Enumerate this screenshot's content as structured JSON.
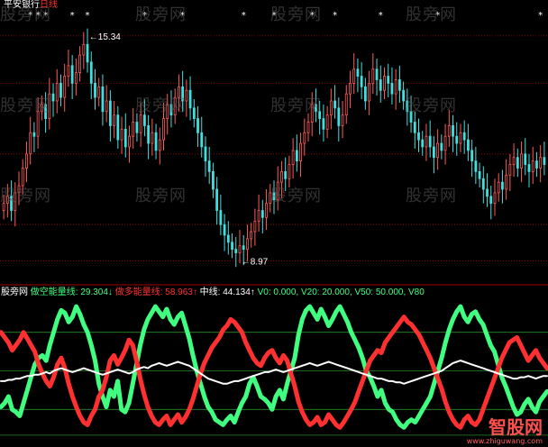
{
  "top_panel": {
    "stock_name": "平安银行",
    "period": "日线",
    "high_marker": "15.34",
    "low_marker": "8.97",
    "colors": {
      "up": "#ff5a5a",
      "down": "#40e0e0",
      "grid": "#a00000",
      "star": "#ffffff"
    }
  },
  "bottom_panel": {
    "indicator_name": "股旁网",
    "items": [
      {
        "label": "做空能量线: ",
        "value": "29.304↓",
        "color": "#40ff80"
      },
      {
        "label": "做多能量线: ",
        "value": "58.963↑",
        "color": "#ff3030"
      },
      {
        "label": "中线: ",
        "value": "44.134↑",
        "color": "#ffffff"
      },
      {
        "label": "V0: ",
        "value": "0.000",
        "color": "#40ff80"
      },
      {
        "label": "V20: ",
        "value": "20.000",
        "color": "#40ff80"
      },
      {
        "label": "V50: ",
        "value": "50.000",
        "color": "#40ff80"
      },
      {
        "label": "V80",
        "value": "",
        "color": "#40ff80"
      }
    ],
    "ref_levels": [
      0,
      20,
      50,
      80
    ]
  },
  "watermark": "股旁网",
  "brand": {
    "main": "智股网",
    "sub": "www.zhiguwang.com"
  },
  "chart_data": [
    {
      "type": "candlestick",
      "title": "平安银行 日线",
      "ylim": [
        8.5,
        16.0
      ],
      "annotations": [
        {
          "text": "15.34",
          "kind": "high",
          "value": 15.34
        },
        {
          "text": "8.97",
          "kind": "low",
          "value": 8.97
        }
      ],
      "closes": [
        10.6,
        10.8,
        10.4,
        10.9,
        11.1,
        11.6,
        12.0,
        12.6,
        12.5,
        13.2,
        13.4,
        13.0,
        13.7,
        13.5,
        14.0,
        13.6,
        14.2,
        14.5,
        14.0,
        14.3,
        14.8,
        15.1,
        14.6,
        14.0,
        13.6,
        13.9,
        13.2,
        13.5,
        12.8,
        13.1,
        12.4,
        12.7,
        12.2,
        12.5,
        12.9,
        12.6,
        13.1,
        12.8,
        12.3,
        12.6,
        12.1,
        12.4,
        13.0,
        13.4,
        13.1,
        13.6,
        13.9,
        13.5,
        13.8,
        13.3,
        13.0,
        12.6,
        12.2,
        11.8,
        11.5,
        11.0,
        10.4,
        10.0,
        9.7,
        9.5,
        9.3,
        9.2,
        9.4,
        9.3,
        9.6,
        9.8,
        10.1,
        10.4,
        10.2,
        10.6,
        10.9,
        10.7,
        11.2,
        11.5,
        11.3,
        11.7,
        12.1,
        11.8,
        12.3,
        12.6,
        12.9,
        13.4,
        13.2,
        13.0,
        12.7,
        13.1,
        13.5,
        13.3,
        12.8,
        13.1,
        13.7,
        14.0,
        14.4,
        14.2,
        13.9,
        13.5,
        14.0,
        14.4,
        14.1,
        13.8,
        14.2,
        14.0,
        13.7,
        14.1,
        13.8,
        13.5,
        13.2,
        12.9,
        12.6,
        12.4,
        12.2,
        12.5,
        12.2,
        11.9,
        12.3,
        12.1,
        12.5,
        12.8,
        12.5,
        12.3,
        12.6,
        12.4,
        12.1,
        11.8,
        11.5,
        11.3,
        11.0,
        10.8,
        10.6,
        10.9,
        11.2,
        11.0,
        11.4,
        11.7,
        11.9,
        11.6,
        12.0,
        11.7,
        11.5,
        11.8,
        11.6,
        11.9,
        11.7
      ],
      "star_signals": [
        7,
        9,
        11,
        18,
        22,
        37,
        47,
        63,
        71,
        81,
        87,
        99,
        114,
        141
      ]
    },
    {
      "type": "line",
      "title": "股旁网",
      "ylim": [
        -5,
        105
      ],
      "reference_lines": [
        0,
        20,
        50,
        80
      ],
      "series": [
        {
          "name": "做空能量线",
          "color": "#40ff80",
          "values": [
            22,
            25,
            30,
            20,
            18,
            15,
            25,
            35,
            45,
            55,
            60,
            62,
            58,
            70,
            80,
            90,
            97,
            95,
            88,
            92,
            100,
            94,
            86,
            80,
            70,
            58,
            40,
            30,
            22,
            35,
            30,
            42,
            20,
            18,
            25,
            40,
            55,
            70,
            82,
            90,
            95,
            100,
            96,
            92,
            98,
            90,
            86,
            92,
            95,
            85,
            75,
            62,
            50,
            40,
            30,
            22,
            18,
            12,
            10,
            8,
            12,
            15,
            10,
            18,
            25,
            30,
            40,
            45,
            38,
            30,
            28,
            25,
            20,
            30,
            35,
            28,
            40,
            50,
            60,
            78,
            90,
            97,
            100,
            95,
            90,
            98,
            92,
            85,
            90,
            96,
            100,
            94,
            88,
            80,
            74,
            68,
            60,
            50,
            45,
            38,
            30,
            35,
            25,
            20,
            18,
            12,
            8,
            6,
            10,
            12,
            10,
            15,
            20,
            25,
            30,
            40,
            50,
            60,
            72,
            82,
            90,
            96,
            100,
            92,
            88,
            94,
            96,
            90,
            86,
            78,
            70,
            65,
            55,
            45,
            38,
            30,
            22,
            16,
            18,
            24,
            28,
            22,
            18,
            26,
            30,
            34
          ]
        },
        {
          "name": "做多能量线",
          "color": "#ff3030",
          "values": [
            80,
            76,
            72,
            66,
            70,
            74,
            80,
            75,
            70,
            65,
            55,
            48,
            42,
            38,
            45,
            55,
            60,
            52,
            40,
            30,
            22,
            15,
            10,
            8,
            15,
            20,
            30,
            35,
            45,
            58,
            62,
            55,
            60,
            66,
            74,
            70,
            58,
            44,
            32,
            22,
            15,
            10,
            8,
            12,
            15,
            8,
            12,
            16,
            10,
            14,
            20,
            28,
            38,
            48,
            56,
            62,
            68,
            72,
            76,
            82,
            85,
            90,
            88,
            84,
            80,
            72,
            66,
            60,
            56,
            54,
            60,
            64,
            66,
            60,
            56,
            62,
            58,
            48,
            38,
            26,
            18,
            12,
            8,
            10,
            14,
            8,
            10,
            16,
            12,
            8,
            6,
            10,
            15,
            20,
            26,
            34,
            42,
            50,
            58,
            62,
            66,
            64,
            72,
            76,
            80,
            84,
            88,
            92,
            88,
            86,
            82,
            78,
            72,
            66,
            60,
            52,
            44,
            36,
            26,
            18,
            12,
            8,
            6,
            12,
            15,
            10,
            8,
            12,
            20,
            28,
            36,
            44,
            52,
            60,
            66,
            72,
            74,
            76,
            70,
            64,
            58,
            62,
            66,
            60,
            56,
            52
          ]
        },
        {
          "name": "中线",
          "color": "#ffffff",
          "values": [
            42,
            42,
            43,
            43,
            44,
            44,
            45,
            46,
            46,
            47,
            47,
            48,
            49,
            48,
            50,
            51,
            52,
            51,
            50,
            49,
            50,
            51,
            52,
            51,
            50,
            49,
            48,
            47,
            48,
            49,
            50,
            51,
            50,
            49,
            48,
            49,
            51,
            52,
            53,
            52,
            54,
            55,
            56,
            55,
            54,
            55,
            56,
            57,
            56,
            55,
            54,
            52,
            50,
            48,
            46,
            44,
            43,
            42,
            41,
            40,
            40,
            41,
            42,
            42,
            43,
            44,
            45,
            46,
            47,
            48,
            49,
            49,
            50,
            51,
            50,
            49,
            50,
            51,
            52,
            53,
            54,
            55,
            56,
            55,
            54,
            55,
            56,
            57,
            56,
            55,
            54,
            53,
            52,
            51,
            50,
            49,
            48,
            47,
            46,
            45,
            44,
            44,
            43,
            42,
            42,
            41,
            41,
            40,
            41,
            42,
            43,
            44,
            45,
            46,
            47,
            48,
            49,
            50,
            52,
            54,
            56,
            57,
            58,
            57,
            56,
            55,
            54,
            53,
            52,
            51,
            50,
            49,
            48,
            47,
            46,
            45,
            44,
            44,
            45,
            45,
            46,
            45,
            44,
            45,
            46,
            46
          ]
        }
      ]
    }
  ]
}
